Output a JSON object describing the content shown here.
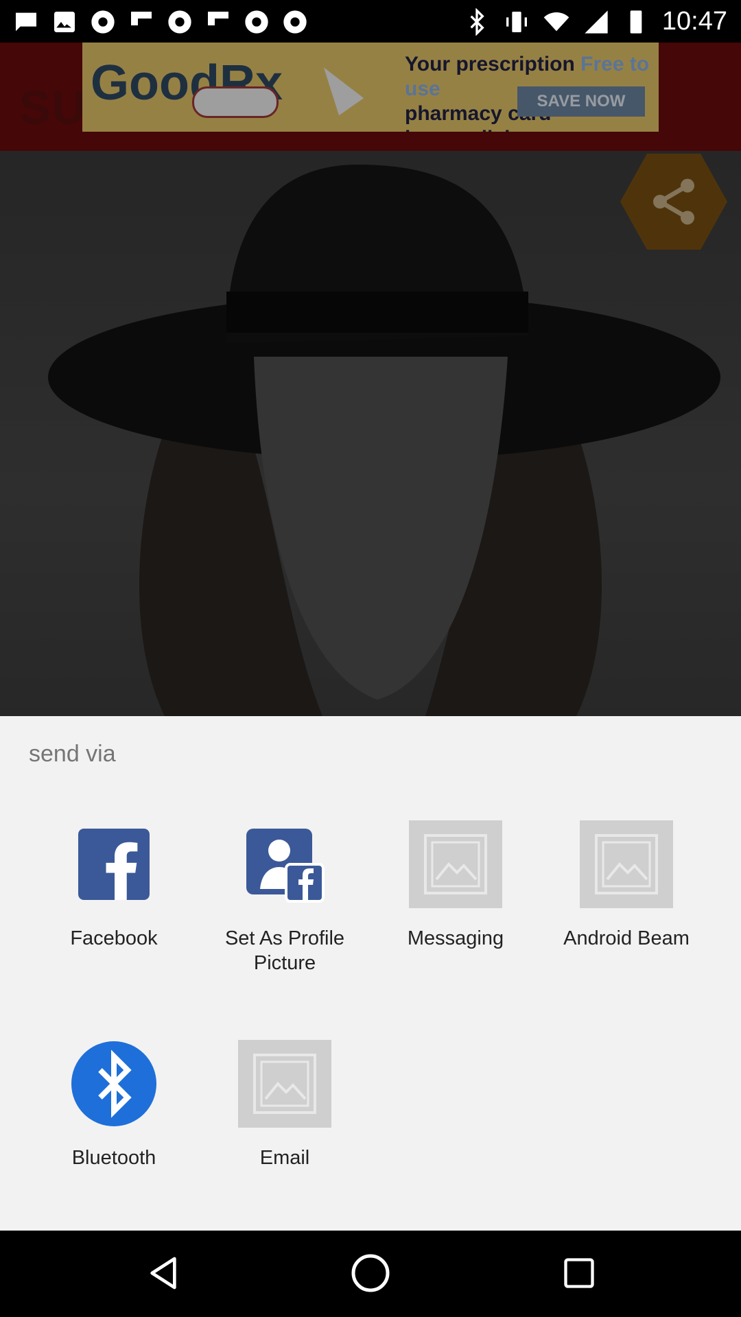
{
  "status_bar": {
    "time": "10:47",
    "left_icons": [
      "message-icon",
      "image-icon",
      "chrome-icon",
      "flipboard-icon",
      "chrome-icon",
      "flipboard-icon",
      "chrome-icon",
      "chrome-icon"
    ],
    "right_icons": [
      "bluetooth-icon",
      "vibrate-icon",
      "wifi-icon",
      "signal-icon",
      "battery-icon"
    ]
  },
  "background_app": {
    "title_fragment": "SU",
    "ad": {
      "brand": "GoodRx",
      "line1_a": "Your prescription",
      "line1_b": "Free to use",
      "line2": "pharmacy card",
      "line3": "is one click away.",
      "cta": "SAVE NOW"
    }
  },
  "share_sheet": {
    "title": "send via",
    "apps": [
      {
        "label": "Facebook",
        "icon": "facebook-icon"
      },
      {
        "label": "Set As Profile Picture",
        "icon": "profile-picture-icon"
      },
      {
        "label": "Messaging",
        "icon": "image-placeholder-icon"
      },
      {
        "label": "Android Beam",
        "icon": "image-placeholder-icon"
      },
      {
        "label": "Bluetooth",
        "icon": "bluetooth-icon"
      },
      {
        "label": "Email",
        "icon": "image-placeholder-icon"
      }
    ]
  },
  "nav_bar": [
    "back-icon",
    "home-icon",
    "recents-icon"
  ],
  "colors": {
    "sheet_bg": "#f2f2f2",
    "facebook_blue": "#3b5998",
    "bluetooth_blue": "#1e6fd9"
  }
}
